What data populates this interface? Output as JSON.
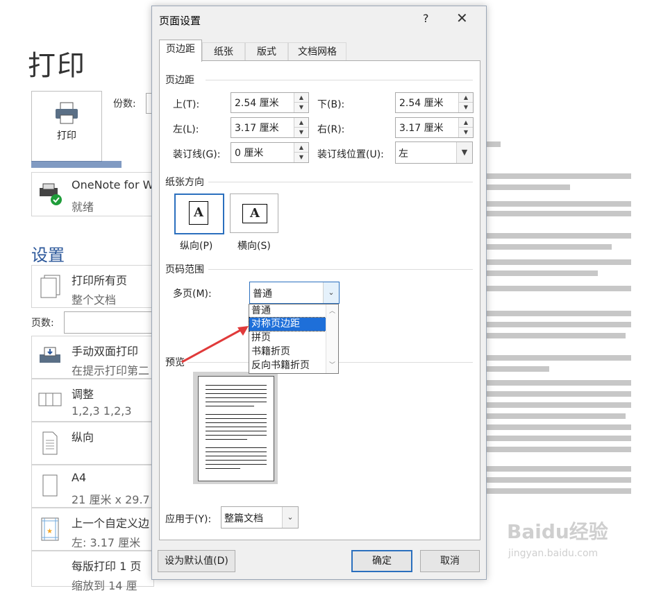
{
  "backstage": {
    "title": "打印",
    "print_button": "打印",
    "copies_label": "份数:",
    "printer_name": "OneNote for W",
    "printer_status": "就绪",
    "settings_heading": "设置",
    "pages_label": "页数:",
    "items": [
      {
        "title": "打印所有页",
        "subtitle": "整个文档"
      },
      {
        "title": "手动双面打印",
        "subtitle": "在提示打印第二"
      },
      {
        "title": "调整",
        "subtitle": "1,2,3    1,2,3"
      },
      {
        "title": "纵向",
        "subtitle": ""
      },
      {
        "title": "A4",
        "subtitle": "21 厘米 x 29.7"
      },
      {
        "title": "上一个自定义边",
        "subtitle": "左: 3.17 厘米"
      },
      {
        "title": "每版打印 1 页",
        "subtitle": "缩放到 14 厘"
      }
    ]
  },
  "watermark": {
    "logo": "Baidu经验",
    "url": "jingyan.baidu.com"
  },
  "dialog": {
    "title": "页面设置",
    "help": "?",
    "close": "✕",
    "tabs": [
      "页边距",
      "纸张",
      "版式",
      "文档网格"
    ],
    "margins": {
      "heading": "页边距",
      "top_label": "上(T):",
      "top_value": "2.54 厘米",
      "bottom_label": "下(B):",
      "bottom_value": "2.54 厘米",
      "left_label": "左(L):",
      "left_value": "3.17 厘米",
      "right_label": "右(R):",
      "right_value": "3.17 厘米",
      "gutter_label": "装订线(G):",
      "gutter_value": "0 厘米",
      "gutter_pos_label": "装订线位置(U):",
      "gutter_pos_value": "左"
    },
    "orientation": {
      "heading": "纸张方向",
      "portrait": "纵向(P)",
      "landscape": "横向(S)"
    },
    "pages": {
      "heading": "页码范围",
      "multiple_label": "多页(M):",
      "multiple_value": "普通",
      "options": [
        "普通",
        "对称页边距",
        "拼页",
        "书籍折页",
        "反向书籍折页"
      ],
      "selected_option": "对称页边距"
    },
    "preview_heading": "预览",
    "apply_label": "应用于(Y):",
    "apply_value": "整篇文档",
    "set_default": "设为默认值(D)",
    "ok": "确定",
    "cancel": "取消"
  },
  "colors": {
    "accent": "#2b579a",
    "selection": "#1e6fd9",
    "arrow": "#e03a3a"
  }
}
